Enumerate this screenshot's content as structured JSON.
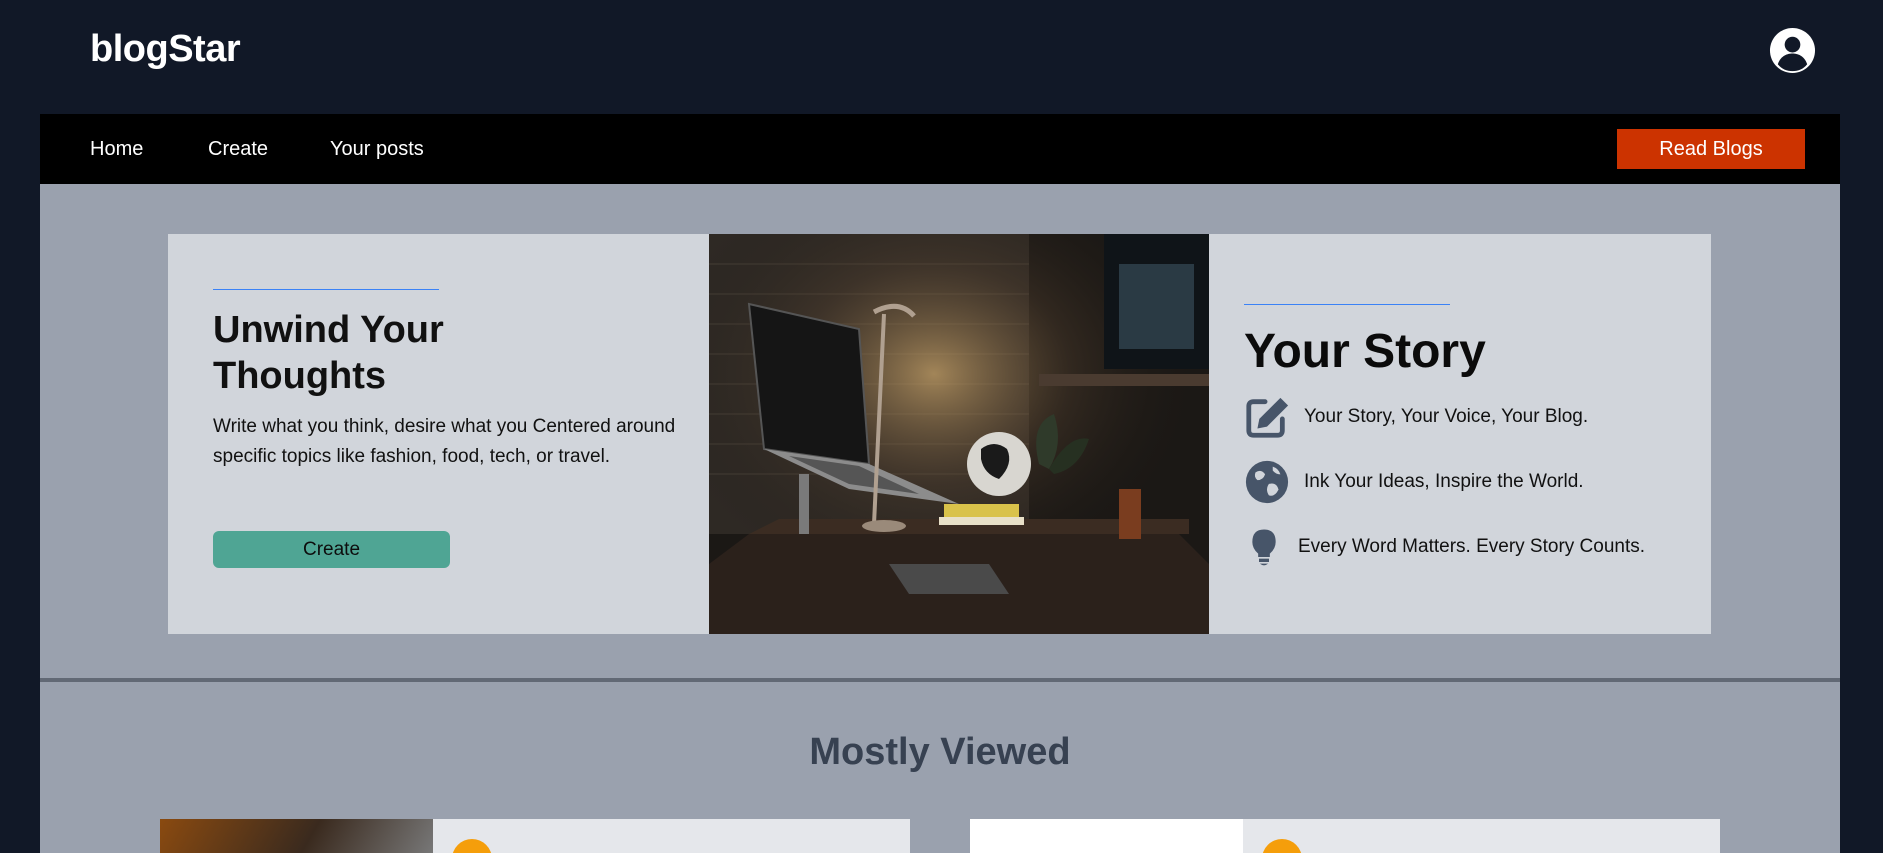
{
  "header": {
    "brand": "blogStar",
    "avatar_icon": "user-circle-icon"
  },
  "nav": {
    "links": [
      "Home",
      "Create",
      "Your posts"
    ],
    "cta_label": "Read Blogs"
  },
  "hero": {
    "title": "Unwind Your Thoughts",
    "description": "Write what you think, desire what you Centered around specific topics like fashion, food, tech, or travel.",
    "create_label": "Create",
    "image_subject": "laptop-on-desk-photo",
    "story": {
      "title": "Your Story",
      "items": [
        {
          "icon": "edit-icon",
          "text": "Your Story, Your Voice, Your Blog."
        },
        {
          "icon": "globe-icon",
          "text": "Ink Your Ideas, Inspire the World."
        },
        {
          "icon": "lightbulb-icon",
          "text": "Every Word Matters. Every Story Counts."
        }
      ]
    }
  },
  "mostly_viewed": {
    "title": "Mostly Viewed"
  },
  "colors": {
    "page_bg": "#111827",
    "nav_bg": "#000000",
    "cta": "#cc3300",
    "create_button": "#4fa594",
    "accent_line": "#3b82f6",
    "main_bg": "#9aa1ae",
    "card_bg": "#d1d5db",
    "badge": "#f59e0b"
  }
}
